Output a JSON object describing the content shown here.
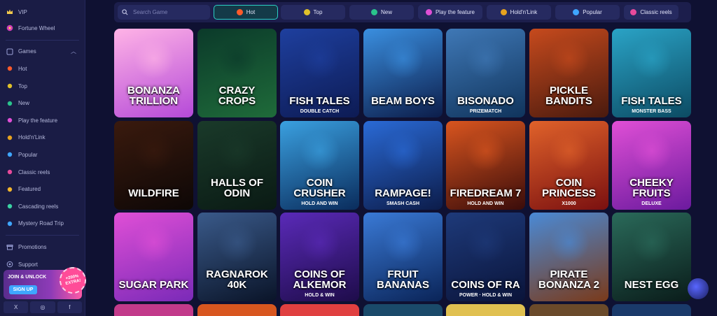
{
  "sidebar": {
    "top_items": [
      {
        "label": "VIP",
        "icon": "crown-icon"
      },
      {
        "label": "Fortune Wheel",
        "icon": "wheel-icon"
      }
    ],
    "games_label": "Games",
    "game_items": [
      {
        "label": "Hot",
        "icon": "fire-icon",
        "color": "#ff5a2a"
      },
      {
        "label": "Top",
        "icon": "star-icon",
        "color": "#e0c12a"
      },
      {
        "label": "New",
        "icon": "new-icon",
        "color": "#2ac38c"
      },
      {
        "label": "Play the feature",
        "icon": "sparkle-icon",
        "color": "#e04fd6"
      },
      {
        "label": "Hold'n'Link",
        "icon": "link-icon",
        "color": "#e6a21f"
      },
      {
        "label": "Popular",
        "icon": "bolt-icon",
        "color": "#3fa6ff"
      },
      {
        "label": "Classic reels",
        "icon": "reels-icon",
        "color": "#e84a9b"
      },
      {
        "label": "Featured",
        "icon": "featured-icon",
        "color": "#f2b52c"
      },
      {
        "label": "Cascading reels",
        "icon": "cascade-icon",
        "color": "#3bd2a3"
      },
      {
        "label": "Mystery Road Trip",
        "icon": "car-icon",
        "color": "#3fa6ff"
      }
    ],
    "bottom_items": [
      {
        "label": "Promotions",
        "icon": "gift-icon"
      },
      {
        "label": "Support",
        "icon": "support-icon"
      }
    ],
    "promo": {
      "text": "JOIN & UNLOCK",
      "signup": "SIGN UP",
      "badge_top": "+200%",
      "badge_bottom": "EXTRA!"
    },
    "socials": [
      "X",
      "◎",
      "f"
    ]
  },
  "search": {
    "placeholder": "Search Game"
  },
  "tabs": [
    {
      "label": "Hot",
      "color": "#ff5a2a",
      "active": true
    },
    {
      "label": "Top",
      "color": "#e0c12a"
    },
    {
      "label": "New",
      "color": "#2ac38c"
    },
    {
      "label": "Play the feature",
      "color": "#e04fd6"
    },
    {
      "label": "Hold'n'Link",
      "color": "#e6a21f"
    },
    {
      "label": "Popular",
      "color": "#3fa6ff"
    },
    {
      "label": "Classic reels",
      "color": "#e84a9b"
    }
  ],
  "games": [
    {
      "title": "BONANZA TRILLION",
      "sub": "",
      "bg": [
        "#ffb3e6",
        "#b54ad8"
      ]
    },
    {
      "title": "CRAZY CROPS",
      "sub": "",
      "bg": [
        "#0b3a2a",
        "#1f6b3a"
      ]
    },
    {
      "title": "FISH TALES",
      "sub": "DOUBLE CATCH",
      "bg": [
        "#1e3f9e",
        "#0d1b54"
      ]
    },
    {
      "title": "BEAM BOYS",
      "sub": "",
      "bg": [
        "#3a8fe0",
        "#0c1d4a"
      ]
    },
    {
      "title": "BISONADO",
      "sub": "PRIZEMATCH",
      "bg": [
        "#3f78b6",
        "#10345c"
      ]
    },
    {
      "title": "PICKLE BANDITS",
      "sub": "",
      "bg": [
        "#c64a1d",
        "#4a1a0e"
      ]
    },
    {
      "title": "FISH TALES",
      "sub": "MONSTER BASS",
      "bg": [
        "#2aa3c6",
        "#0c4b63"
      ]
    },
    {
      "title": "WILDFIRE",
      "sub": "",
      "bg": [
        "#3a1a0e",
        "#0d0706"
      ]
    },
    {
      "title": "HALLS OF ODIN",
      "sub": "",
      "bg": [
        "#1a3a2a",
        "#0a1a14"
      ]
    },
    {
      "title": "COIN CRUSHER",
      "sub": "HOLD AND WIN",
      "bg": [
        "#3aa0e0",
        "#0a2c5c"
      ]
    },
    {
      "title": "RAMPAGE!",
      "sub": "SMASH CASH",
      "bg": [
        "#2a6ad6",
        "#0c1c4a"
      ]
    },
    {
      "title": "FIREDREAM 7",
      "sub": "HOLD AND WIN",
      "bg": [
        "#d9551f",
        "#3a0c0a"
      ]
    },
    {
      "title": "COIN PRINCESS",
      "sub": "X1000",
      "bg": [
        "#e0622a",
        "#7a1010"
      ]
    },
    {
      "title": "CHEEKY FRUITS",
      "sub": "DELUXE",
      "bg": [
        "#e04fd6",
        "#6b1a9e"
      ]
    },
    {
      "title": "SUGAR PARK",
      "sub": "",
      "bg": [
        "#e04fd6",
        "#7a2ab8"
      ]
    },
    {
      "title": "RAGNAROK 40K",
      "sub": "",
      "bg": [
        "#3a5a8a",
        "#0a1428"
      ]
    },
    {
      "title": "COINS OF ALKEMOR",
      "sub": "HOLD & WIN",
      "bg": [
        "#5a2ab8",
        "#1e0c4a"
      ]
    },
    {
      "title": "FRUIT BANANAS",
      "sub": "",
      "bg": [
        "#3a7ad6",
        "#0a2458"
      ]
    },
    {
      "title": "COINS OF RA",
      "sub": "POWER · HOLD & WIN",
      "bg": [
        "#1e3a7a",
        "#0a143a"
      ]
    },
    {
      "title": "PIRATE BONANZA 2",
      "sub": "",
      "bg": [
        "#4a8ad6",
        "#7a3a1a"
      ]
    },
    {
      "title": "NEST EGG",
      "sub": "",
      "bg": [
        "#2a6a5a",
        "#0a1c1a"
      ]
    }
  ]
}
